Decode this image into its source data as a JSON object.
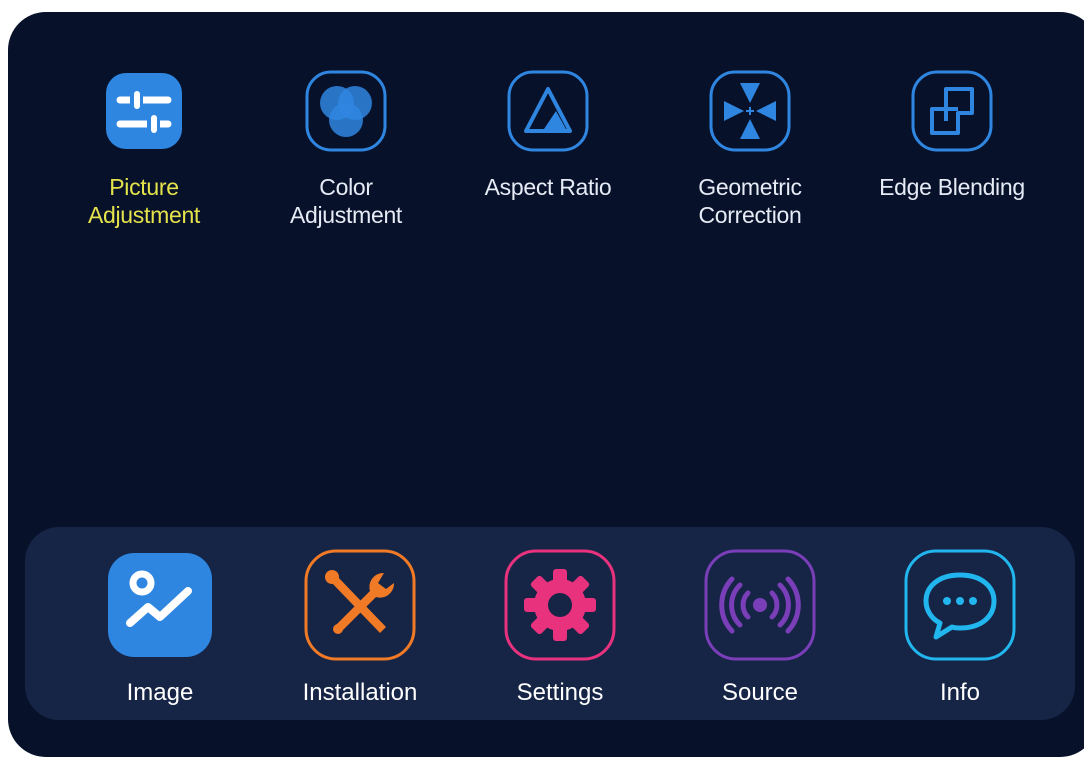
{
  "submenu": {
    "items": [
      {
        "label": "Picture\nAdjustment",
        "icon": "sliders-icon",
        "selected": true
      },
      {
        "label": "Color\nAdjustment",
        "icon": "color-circles-icon",
        "selected": false
      },
      {
        "label": "Aspect Ratio",
        "icon": "triangle-icon",
        "selected": false
      },
      {
        "label": "Geometric\nCorrection",
        "icon": "keystone-arrows-icon",
        "selected": false
      },
      {
        "label": "Edge Blending",
        "icon": "overlap-squares-icon",
        "selected": false
      }
    ]
  },
  "dock": {
    "items": [
      {
        "label": "Image",
        "icon": "image-graph-icon",
        "selected": true
      },
      {
        "label": "Installation",
        "icon": "tools-icon",
        "selected": false
      },
      {
        "label": "Settings",
        "icon": "gear-icon",
        "selected": false
      },
      {
        "label": "Source",
        "icon": "wireless-signal-icon",
        "selected": false
      },
      {
        "label": "Info",
        "icon": "chat-bubble-icon",
        "selected": false
      }
    ]
  },
  "colors": {
    "background": "#07112a",
    "dock": "#162446",
    "selected_text": "#e5e34b",
    "blue": "#2f86e0",
    "orange": "#f07a25",
    "pink": "#e8327e",
    "purple": "#7a3fb8",
    "cyan": "#22b6ee"
  }
}
